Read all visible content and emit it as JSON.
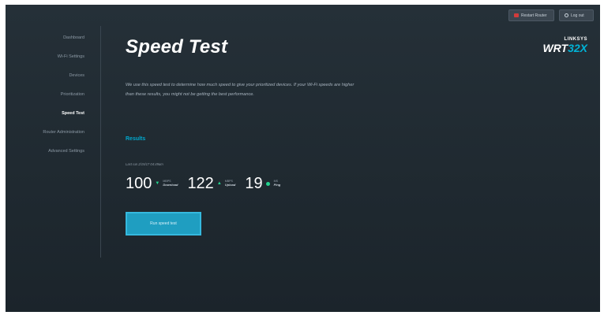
{
  "header": {
    "restart_label": "Restart Router",
    "logout_label": "Log out"
  },
  "brand": {
    "top": "LINKSYS",
    "model_prefix": "WRT",
    "model_accent": "32X",
    "accent_color": "#00b2d6"
  },
  "sidebar": {
    "items": [
      {
        "label": "Dashboard"
      },
      {
        "label": "Wi-Fi Settings"
      },
      {
        "label": "Devices"
      },
      {
        "label": "Prioritization"
      },
      {
        "label": "Speed Test"
      },
      {
        "label": "Router Administration"
      },
      {
        "label": "Advanced Settings"
      }
    ],
    "active": "Speed Test"
  },
  "main": {
    "title": "Speed Test",
    "description": "We use this speed test to determine how much speed to give your prioritized devices. If your Wi-Fi speeds are higher than these results, you might not be getting the best performance.",
    "results_heading": "Results",
    "last_run": "Last run 2/15/17 04:49am",
    "metrics": {
      "download": {
        "value": "100",
        "unit": "MBPS",
        "label": "Download"
      },
      "upload": {
        "value": "122",
        "unit": "MBPS",
        "label": "Upload"
      },
      "ping": {
        "value": "19",
        "unit": "MS",
        "label": "Ping"
      }
    },
    "run_button_label": "Run speed test"
  },
  "colors": {
    "accent": "#00a9cf",
    "status_green": "#23d38e",
    "background": "#222c33"
  },
  "icons": [
    "restart-icon",
    "power-icon",
    "arrow-down-icon",
    "arrow-up-icon",
    "ping-dot-icon"
  ]
}
